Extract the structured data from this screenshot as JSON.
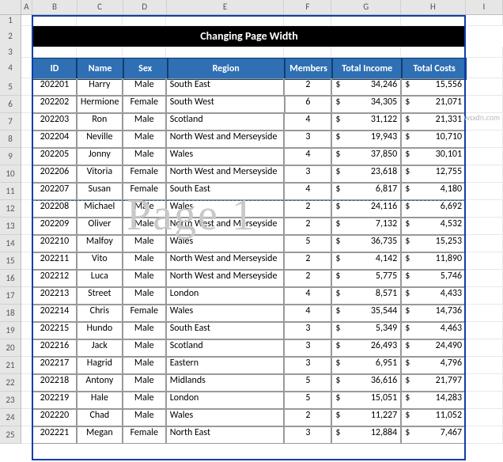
{
  "columns": [
    "A",
    "B",
    "C",
    "D",
    "E",
    "F",
    "G",
    "H",
    "I"
  ],
  "title": "Changing Page Width",
  "watermark": "Page 1",
  "site": "wsxdn.com",
  "headers": {
    "id": "ID",
    "name": "Name",
    "sex": "Sex",
    "region": "Region",
    "members": "Members",
    "income": "Total Income",
    "costs": "Total Costs"
  },
  "rows": [
    {
      "n": 5,
      "id": "202201",
      "name": "Harry",
      "sex": "Male",
      "region": "South East",
      "members": "2",
      "income": "34,246",
      "costs": "15,556"
    },
    {
      "n": 6,
      "id": "202202",
      "name": "Hermione",
      "sex": "Female",
      "region": "South West",
      "members": "6",
      "income": "34,305",
      "costs": "21,071"
    },
    {
      "n": 7,
      "id": "202203",
      "name": "Ron",
      "sex": "Male",
      "region": "Scotland",
      "members": "4",
      "income": "31,122",
      "costs": "21,331"
    },
    {
      "n": 8,
      "id": "202204",
      "name": "Neville",
      "sex": "Male",
      "region": "North West and Merseyside",
      "members": "3",
      "income": "19,943",
      "costs": "10,710"
    },
    {
      "n": 9,
      "id": "202205",
      "name": "Jonny",
      "sex": "Male",
      "region": "Wales",
      "members": "4",
      "income": "37,850",
      "costs": "30,101"
    },
    {
      "n": 10,
      "id": "202206",
      "name": "Vitoria",
      "sex": "Female",
      "region": "North West and Merseyside",
      "members": "3",
      "income": "23,618",
      "costs": "12,755"
    },
    {
      "n": 11,
      "id": "202207",
      "name": "Susan",
      "sex": "Female",
      "region": "South East",
      "members": "4",
      "income": "6,817",
      "costs": "4,180"
    },
    {
      "n": 12,
      "id": "202208",
      "name": "Michael",
      "sex": "Male",
      "region": "Wales",
      "members": "2",
      "income": "24,116",
      "costs": "6,692"
    },
    {
      "n": 13,
      "id": "202209",
      "name": "Oliver",
      "sex": "Male",
      "region": "North West and Merseyside",
      "members": "2",
      "income": "7,132",
      "costs": "4,532"
    },
    {
      "n": 14,
      "id": "202210",
      "name": "Malfoy",
      "sex": "Male",
      "region": "Wales",
      "members": "5",
      "income": "36,735",
      "costs": "15,253"
    },
    {
      "n": 15,
      "id": "202211",
      "name": "Vito",
      "sex": "Male",
      "region": "North West and Merseyside",
      "members": "2",
      "income": "4,142",
      "costs": "11,890"
    },
    {
      "n": 16,
      "id": "202212",
      "name": "Luca",
      "sex": "Male",
      "region": "North West and Merseyside",
      "members": "2",
      "income": "5,775",
      "costs": "5,746"
    },
    {
      "n": 17,
      "id": "202213",
      "name": "Street",
      "sex": "Male",
      "region": "London",
      "members": "4",
      "income": "8,571",
      "costs": "4,433"
    },
    {
      "n": 18,
      "id": "202214",
      "name": "Chris",
      "sex": "Female",
      "region": "Wales",
      "members": "4",
      "income": "35,544",
      "costs": "14,736"
    },
    {
      "n": 19,
      "id": "202215",
      "name": "Hundo",
      "sex": "Male",
      "region": "South East",
      "members": "3",
      "income": "5,349",
      "costs": "4,463"
    },
    {
      "n": 20,
      "id": "202216",
      "name": "Jack",
      "sex": "Male",
      "region": "Scotland",
      "members": "3",
      "income": "26,493",
      "costs": "24,490"
    },
    {
      "n": 21,
      "id": "202217",
      "name": "Hagrid",
      "sex": "Male",
      "region": "Eastern",
      "members": "3",
      "income": "6,951",
      "costs": "4,796"
    },
    {
      "n": 22,
      "id": "202218",
      "name": "Antony",
      "sex": "Male",
      "region": "Midlands",
      "members": "5",
      "income": "36,616",
      "costs": "21,797"
    },
    {
      "n": 23,
      "id": "202219",
      "name": "Hale",
      "sex": "Male",
      "region": "London",
      "members": "5",
      "income": "15,051",
      "costs": "14,283"
    },
    {
      "n": 24,
      "id": "202220",
      "name": "Chad",
      "sex": "Male",
      "region": "Wales",
      "members": "2",
      "income": "11,227",
      "costs": "11,052"
    },
    {
      "n": 25,
      "id": "202221",
      "name": "Megan",
      "sex": "Female",
      "region": "North East",
      "members": "3",
      "income": "12,884",
      "costs": "7,467"
    }
  ]
}
